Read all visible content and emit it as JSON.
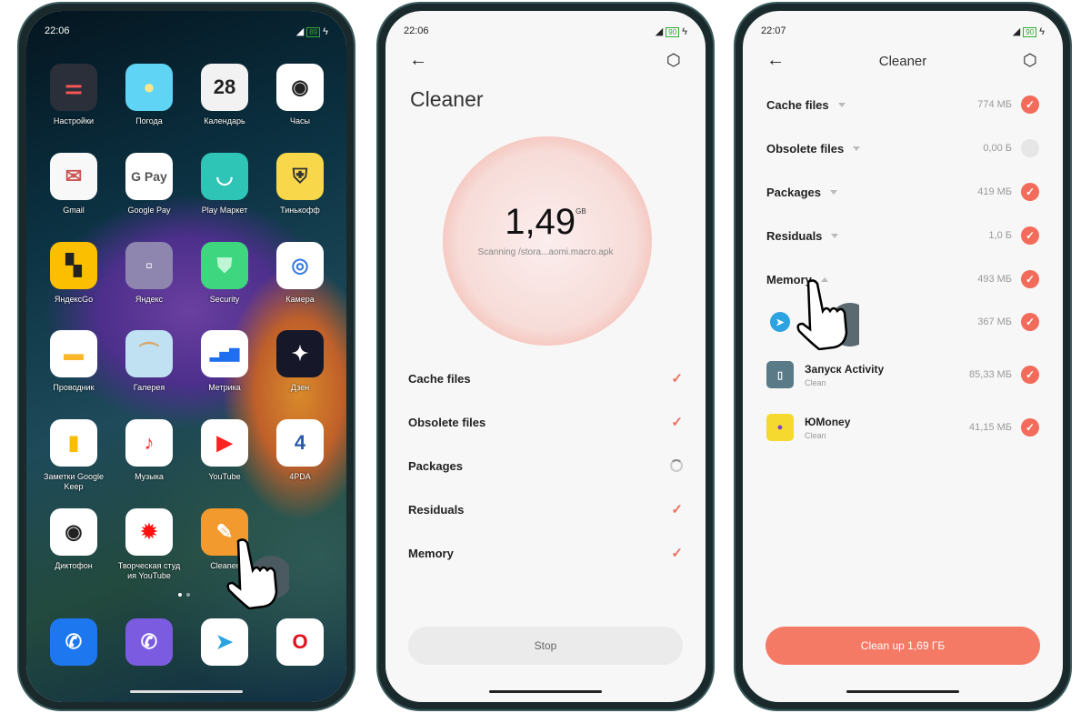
{
  "home": {
    "status": {
      "time": "22:06",
      "battery": "89"
    },
    "apps": [
      {
        "label": "Настройки",
        "icon": "settings-icon",
        "bg": "#2b2f3a",
        "glyph": "⚌",
        "fg": "#f55"
      },
      {
        "label": "Погода",
        "icon": "weather-sun-icon",
        "bg": "#5fd4f5",
        "glyph": "●",
        "fg": "#fbe58a"
      },
      {
        "label": "Календарь",
        "icon": "calendar-icon",
        "bg": "#f2f2f2",
        "glyph": "28",
        "fg": "#222"
      },
      {
        "label": "Часы",
        "icon": "clock-icon",
        "bg": "#fff",
        "glyph": "◉",
        "fg": "#222"
      },
      {
        "label": "Gmail",
        "icon": "mail-icon",
        "bg": "#f8f8f8",
        "glyph": "✉",
        "fg": "#c55"
      },
      {
        "label": "Google Pay",
        "icon": "google-pay-icon",
        "bg": "#fff",
        "glyph": "G Pay",
        "fg": "#555"
      },
      {
        "label": "Play Маркет",
        "icon": "play-market-icon",
        "bg": "#2ec4b6",
        "glyph": "◡",
        "fg": "#fff"
      },
      {
        "label": "Тинькофф",
        "icon": "tinkoff-icon",
        "bg": "#f8d84a",
        "glyph": "⛨",
        "fg": "#333"
      },
      {
        "label": "ЯндексGo",
        "icon": "yandex-go-icon",
        "bg": "#fcbf00",
        "glyph": "▚",
        "fg": "#222"
      },
      {
        "label": "Яндекс",
        "icon": "yandex-folder-icon",
        "bg": "#8f86b0",
        "glyph": "▫",
        "fg": "#fff"
      },
      {
        "label": "Security",
        "icon": "security-shield-icon",
        "bg": "#3ed67e",
        "glyph": "⛊",
        "fg": "#bff5d6"
      },
      {
        "label": "Камера",
        "icon": "camera-icon",
        "bg": "#fff",
        "glyph": "◎",
        "fg": "#3a7de0"
      },
      {
        "label": "Проводник",
        "icon": "folder-icon",
        "bg": "#fff",
        "glyph": "▬",
        "fg": "#fbb72c"
      },
      {
        "label": "Галерея",
        "icon": "gallery-icon",
        "bg": "#bfe1f2",
        "glyph": "⏜",
        "fg": "#d9a66a"
      },
      {
        "label": "Метрика",
        "icon": "metrika-icon",
        "bg": "#fff",
        "glyph": "▂▅▇",
        "fg": "#1e6ef0"
      },
      {
        "label": "Дзен",
        "icon": "dzen-icon",
        "bg": "#16182a",
        "glyph": "✦",
        "fg": "#fff"
      },
      {
        "label": "Заметки Google Keep",
        "icon": "keep-icon",
        "bg": "#fff",
        "glyph": "▮",
        "fg": "#fbbc04"
      },
      {
        "label": "Музыка",
        "icon": "music-icon",
        "bg": "#fff",
        "glyph": "♪",
        "fg": "#f33"
      },
      {
        "label": "YouTube",
        "icon": "youtube-icon",
        "bg": "#fff",
        "glyph": "▶",
        "fg": "#f22"
      },
      {
        "label": "4PDA",
        "icon": "4pda-icon",
        "bg": "#fff",
        "glyph": "4",
        "fg": "#2a5aa8"
      },
      {
        "label": "Диктофон",
        "icon": "recorder-icon",
        "bg": "#fff",
        "glyph": "◉",
        "fg": "#222"
      },
      {
        "label": "Творческая студ ия YouTube",
        "icon": "youtube-studio-icon",
        "bg": "#fff",
        "glyph": "✹",
        "fg": "#f11"
      },
      {
        "label": "Cleaner",
        "icon": "cleaner-brush-icon",
        "bg": "#f29a2e",
        "glyph": "✎",
        "fg": "#fff"
      }
    ],
    "dock": [
      {
        "icon": "phone-icon",
        "bg": "#1d78f0",
        "glyph": "✆",
        "fg": "#fff"
      },
      {
        "icon": "viber-icon",
        "bg": "#7b5ce0",
        "glyph": "✆",
        "fg": "#fff"
      },
      {
        "icon": "telegram-icon",
        "bg": "#fff",
        "glyph": "➤",
        "fg": "#2aa3e0"
      },
      {
        "icon": "opera-icon",
        "bg": "#fff",
        "glyph": "O",
        "fg": "#e0101e"
      }
    ]
  },
  "scan": {
    "status": {
      "time": "22:06",
      "battery": "90"
    },
    "title": "Cleaner",
    "amount": "1,49",
    "unit": "GB",
    "scanning": "Scanning /stora...aomi.macro.apk",
    "items": [
      {
        "label": "Cache files",
        "state": "done"
      },
      {
        "label": "Obsolete files",
        "state": "done"
      },
      {
        "label": "Packages",
        "state": "scanning"
      },
      {
        "label": "Residuals",
        "state": "done"
      },
      {
        "label": "Memory",
        "state": "done"
      }
    ],
    "stop_label": "Stop"
  },
  "result": {
    "status": {
      "time": "22:07",
      "battery": "90"
    },
    "title": "Cleaner",
    "items": [
      {
        "label": "Cache files",
        "size": "774 МБ",
        "checked": true
      },
      {
        "label": "Obsolete files",
        "size": "0,00 Б",
        "checked": false
      },
      {
        "label": "Packages",
        "size": "419 МБ",
        "checked": true
      },
      {
        "label": "Residuals",
        "size": "1,0 Б",
        "checked": true
      },
      {
        "label": "Memory",
        "size": "493 МБ",
        "checked": true
      }
    ],
    "memory_apps": [
      {
        "name": "",
        "sub": "",
        "size": "367 МБ",
        "icon": "telegram-icon"
      },
      {
        "name": "Запуск Activity",
        "sub": "Clean",
        "size": "85,33 МБ",
        "icon": "activity-launcher-icon"
      },
      {
        "name": "ЮMoney",
        "sub": "Clean",
        "size": "41,15 МБ",
        "icon": "yumoney-icon"
      }
    ],
    "clean_label": "Clean up 1,69 ГБ"
  },
  "colors": {
    "accent": "#f26b5b",
    "button": "#f47a66"
  }
}
